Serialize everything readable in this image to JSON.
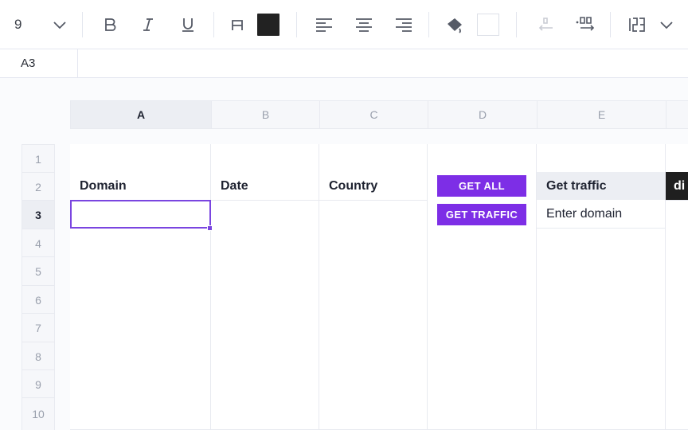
{
  "toolbar": {
    "font_size": "9",
    "icons": [
      "chevron-down-icon",
      "bold-icon",
      "italic-icon",
      "underline-icon",
      "text-color-icon",
      "align-left-icon",
      "align-center-icon",
      "align-right-icon",
      "fill-color-icon",
      "decrease-decimal-icon",
      "increase-decimal-icon",
      "number-format-icon",
      "chevron-down-icon"
    ],
    "text_color": "#222222",
    "fill_color": "#ffffff"
  },
  "formula_bar": {
    "cell_ref": "A3"
  },
  "columns": [
    "A",
    "B",
    "C",
    "D",
    "E"
  ],
  "rows": [
    "1",
    "2",
    "3",
    "4",
    "5",
    "6",
    "7",
    "8",
    "9",
    "10"
  ],
  "active": {
    "column": "A",
    "row": "3"
  },
  "cells": {
    "A2": "Domain",
    "B2": "Date",
    "C2": "Country",
    "E2": "Get traffic",
    "F2": "di",
    "E3": "Enter domain"
  },
  "buttons": {
    "get_all": "GET ALL",
    "get_traffic": "GET TRAFFIC"
  },
  "colors": {
    "accent": "#7d2ee6",
    "selection": "#7a45e0"
  }
}
